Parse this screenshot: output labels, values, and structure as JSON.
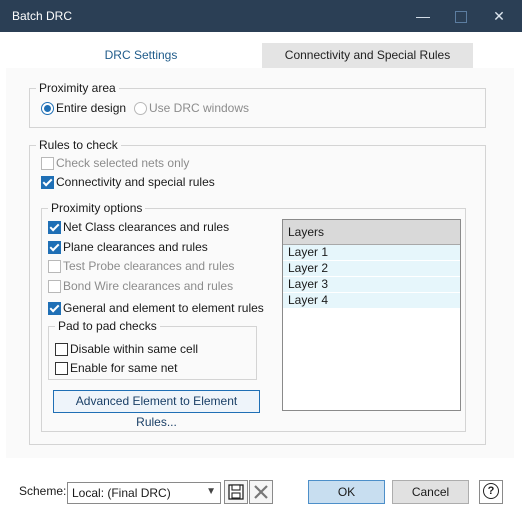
{
  "window": {
    "title": "Batch DRC",
    "minimize": "—",
    "close": "✕"
  },
  "tabs": [
    {
      "label": "DRC Settings",
      "active": true
    },
    {
      "label": "Connectivity and Special Rules",
      "active": false
    }
  ],
  "proximity_area": {
    "legend": "Proximity area",
    "options": [
      {
        "label": "Entire design",
        "checked": true,
        "enabled": true
      },
      {
        "label": "Use DRC windows",
        "checked": false,
        "enabled": false
      }
    ]
  },
  "rules_to_check": {
    "legend": "Rules to check",
    "check_selected_nets_only": {
      "label": "Check selected nets only",
      "checked": false,
      "enabled": false
    },
    "connectivity_special_rules": {
      "label": "Connectivity and special rules",
      "checked": true,
      "enabled": true
    },
    "proximity_options": {
      "legend": "Proximity options",
      "items": [
        {
          "label": "Net Class clearances and rules",
          "checked": true,
          "enabled": true
        },
        {
          "label": "Plane clearances and rules",
          "checked": true,
          "enabled": true
        },
        {
          "label": "Test Probe clearances and rules",
          "checked": false,
          "enabled": false
        },
        {
          "label": "Bond Wire clearances and rules",
          "checked": false,
          "enabled": false
        },
        {
          "label": "General and element to element rules",
          "checked": true,
          "enabled": true
        }
      ],
      "pad_to_pad": {
        "legend": "Pad to pad checks",
        "items": [
          {
            "label": "Disable within same cell",
            "checked": false
          },
          {
            "label": "Enable for same net",
            "checked": false
          }
        ]
      },
      "advanced_button": "Advanced Element to Element Rules..."
    },
    "layers": {
      "header": "Layers",
      "items": [
        "Layer 1",
        "Layer 2",
        "Layer 3",
        "Layer 4"
      ]
    }
  },
  "footer": {
    "scheme_label": "Scheme:",
    "scheme_value": "Local: (Final DRC)",
    "ok": "OK",
    "cancel": "Cancel",
    "help": "?"
  },
  "colors": {
    "titlebar": "#2b3f55",
    "accent": "#1f6fb5",
    "layer_row": "#e6f6fb"
  },
  "icons": [
    "save-icon",
    "delete-icon",
    "help-icon",
    "dropdown-arrow-icon",
    "minimize-icon",
    "maximize-icon",
    "close-icon"
  ]
}
